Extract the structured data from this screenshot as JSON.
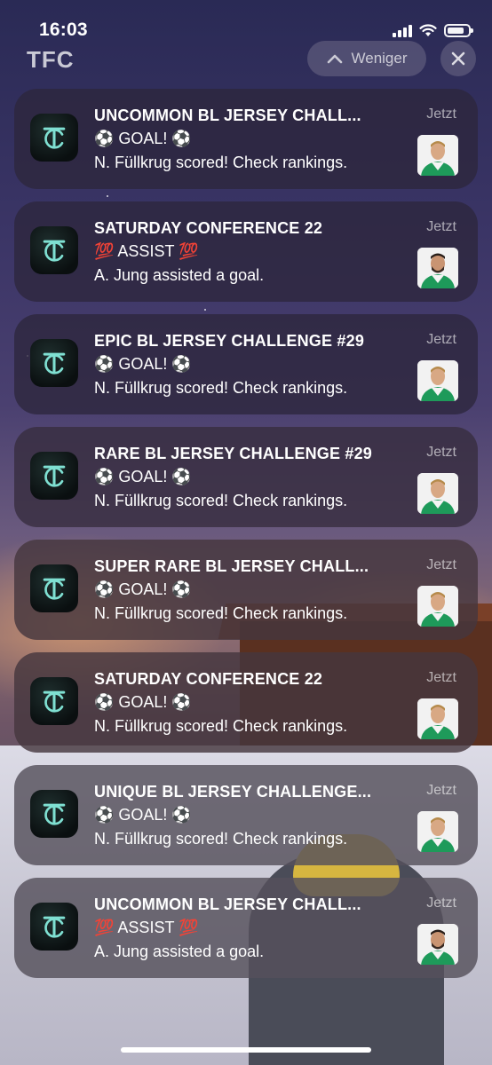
{
  "status_bar": {
    "time": "16:03",
    "icons": [
      "signal-icon",
      "wifi-icon",
      "battery-icon"
    ]
  },
  "group": {
    "app_name": "TFC",
    "less_label": "Weniger",
    "less_icon": "chevron-up-icon",
    "close_icon": "close-icon"
  },
  "notifications": [
    {
      "title": "UNCOMMON BL JERSEY CHALL...",
      "line2": "⚽ GOAL! ⚽",
      "line3": "N. Füllkrug scored! Check rankings.",
      "time": "Jetzt",
      "avatar": "player-fullkrug"
    },
    {
      "title": "SATURDAY CONFERENCE 22",
      "line2": "💯 ASSIST 💯",
      "line3": "A. Jung assisted a goal.",
      "time": "Jetzt",
      "avatar": "player-jung"
    },
    {
      "title": "EPIC BL JERSEY CHALLENGE #29",
      "line2": "⚽ GOAL! ⚽",
      "line3": "N. Füllkrug scored! Check rankings.",
      "time": "Jetzt",
      "avatar": "player-fullkrug"
    },
    {
      "title": "RARE BL JERSEY CHALLENGE #29",
      "line2": "⚽ GOAL! ⚽",
      "line3": "N. Füllkrug scored! Check rankings.",
      "time": "Jetzt",
      "avatar": "player-fullkrug"
    },
    {
      "title": "SUPER RARE BL JERSEY CHALL...",
      "line2": "⚽ GOAL! ⚽",
      "line3": "N. Füllkrug scored! Check rankings.",
      "time": "Jetzt",
      "avatar": "player-fullkrug"
    },
    {
      "title": "SATURDAY CONFERENCE 22",
      "line2": "⚽ GOAL! ⚽",
      "line3": "N. Füllkrug scored! Check rankings.",
      "time": "Jetzt",
      "avatar": "player-fullkrug"
    },
    {
      "title": "UNIQUE BL JERSEY CHALLENGE...",
      "line2": "⚽ GOAL! ⚽",
      "line3": "N. Füllkrug scored! Check rankings.",
      "time": "Jetzt",
      "avatar": "player-fullkrug"
    },
    {
      "title": "UNCOMMON BL JERSEY CHALL...",
      "line2": "💯 ASSIST 💯",
      "line3": "A. Jung assisted a goal.",
      "time": "Jetzt",
      "avatar": "player-jung"
    }
  ],
  "colors": {
    "app_icon_bg": "#0d1515",
    "app_icon_logo": "#7fe0d2",
    "jersey_green": "#1e9a5a",
    "jersey_white": "#f4f4f4"
  }
}
